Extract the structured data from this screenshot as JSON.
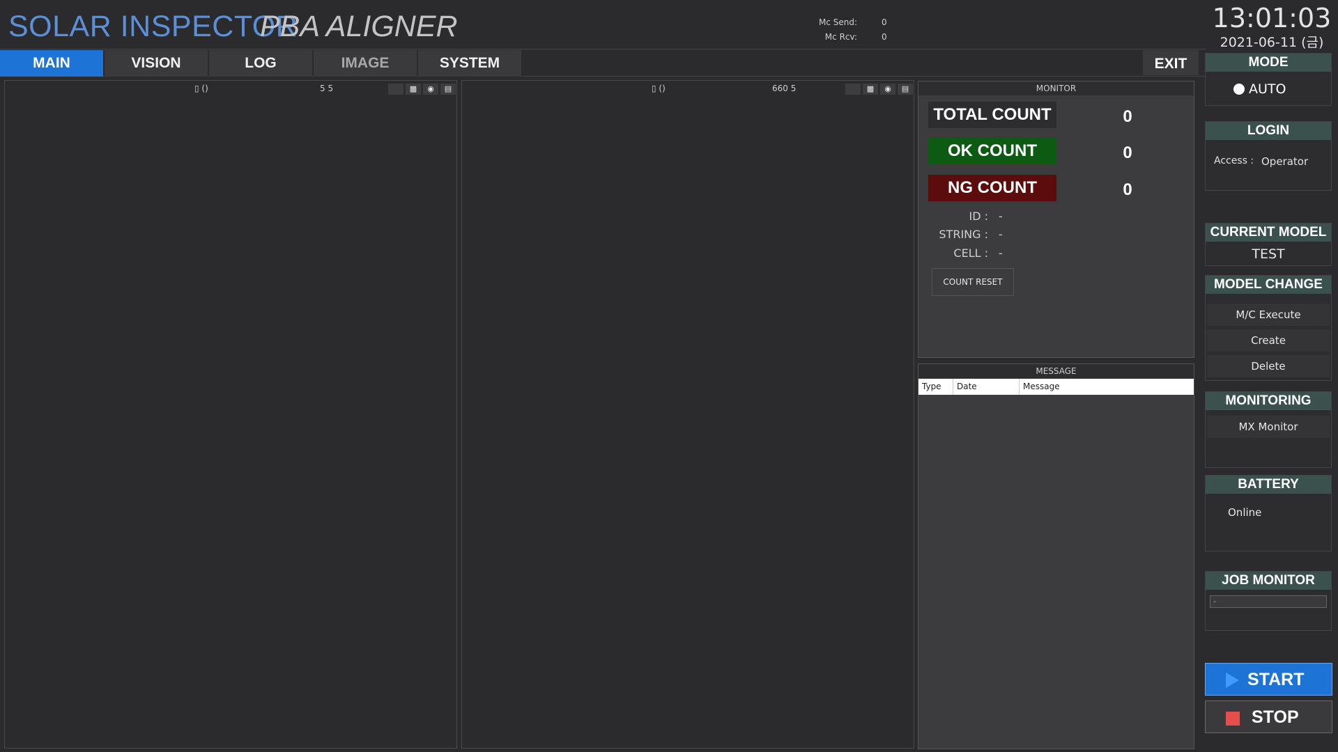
{
  "header": {
    "app_title": "SOLAR INSPECTOR",
    "app_subtitle": "PBA ALIGNER",
    "mc_send_label": "Mc Send:",
    "mc_send_value": "0",
    "mc_rcv_label": "Mc Rcv:",
    "mc_rcv_value": "0",
    "time": "13:01:03",
    "date": "2021-06-11 (금)"
  },
  "tabs": [
    {
      "label": "MAIN"
    },
    {
      "label": "VISION"
    },
    {
      "label": "LOG"
    },
    {
      "label": "IMAGE"
    },
    {
      "label": "SYSTEM"
    }
  ],
  "exit_label": "EXIT",
  "views": [
    {
      "coord": "▯ ()",
      "info": "5 5"
    },
    {
      "coord": "▯ ()",
      "info": "660 5"
    }
  ],
  "monitor": {
    "title": "MONITOR",
    "total_label": "TOTAL COUNT",
    "total_value": "0",
    "ok_label": "OK COUNT",
    "ok_value": "0",
    "ng_label": "NG COUNT",
    "ng_value": "0",
    "id_label": "ID :",
    "id_value": "-",
    "string_label": "STRING :",
    "string_value": "-",
    "cell_label": "CELL :",
    "cell_value": "-",
    "reset_label": "COUNT RESET",
    "colors": {
      "total": "#2d2d2f",
      "ok": "#0d5a12",
      "ng": "#5c0c0c"
    }
  },
  "message": {
    "title": "MESSAGE",
    "columns": [
      "Type",
      "Date",
      "Message"
    ]
  },
  "sidebar": {
    "mode_title": "MODE",
    "mode_value": "AUTO",
    "login_title": "LOGIN",
    "access_label": "Access :",
    "access_value": "Operator",
    "current_model_title": "CURRENT MODEL",
    "current_model_value": "TEST",
    "model_change_title": "MODEL CHANGE",
    "mc_execute": "M/C Execute",
    "create": "Create",
    "delete": "Delete",
    "monitoring_title": "MONITORING",
    "mx_monitor": "MX Monitor",
    "battery_title": "BATTERY",
    "battery_status": "Online",
    "job_monitor_title": "JOB MONITOR",
    "job_monitor_value": "-",
    "start_label": "START",
    "stop_label": "STOP"
  }
}
